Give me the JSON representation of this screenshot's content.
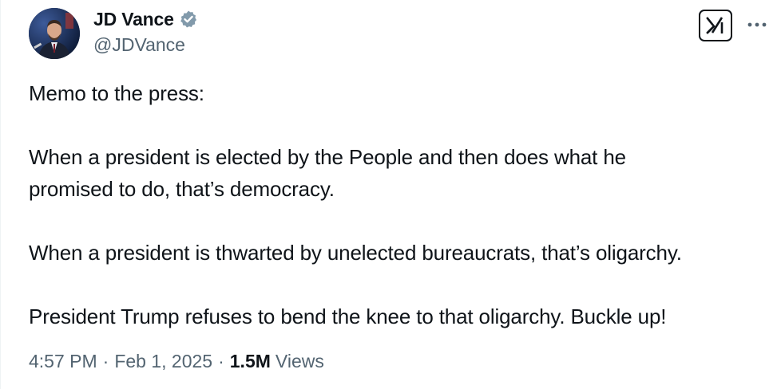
{
  "author": {
    "display_name": "JD Vance",
    "handle": "@JDVance",
    "verified": true,
    "verified_color": "#829aab"
  },
  "icons": {
    "verified": "verified-badge-icon",
    "grok": "grok-icon",
    "more": "more-options-icon"
  },
  "tweet": {
    "lines": [
      "Memo to the press:",
      "",
      "When a president is elected by the People and then does what he",
      "promised to do, that’s democracy.",
      "",
      "When a president is thwarted by unelected bureaucrats, that’s oligarchy.",
      "",
      "President Trump refuses to bend the knee to that oligarchy. Buckle up!"
    ]
  },
  "meta": {
    "time": "4:57 PM",
    "separator": "·",
    "date": "Feb 1, 2025",
    "views_count": "1.5M",
    "views_label": "Views"
  },
  "colors": {
    "text_primary": "#0f1419",
    "text_secondary": "#536471"
  }
}
